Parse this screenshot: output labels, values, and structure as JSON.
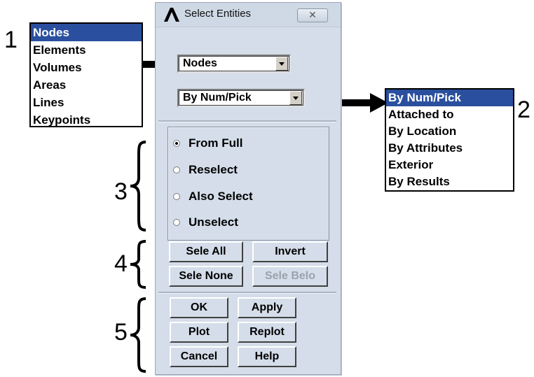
{
  "window": {
    "title": "Select Entities",
    "close_glyph": "✕"
  },
  "entity_combo": {
    "value": "Nodes"
  },
  "method_combo": {
    "value": "By Num/Pick"
  },
  "radio_options": [
    {
      "label": "From Full",
      "selected": true
    },
    {
      "label": "Reselect",
      "selected": false
    },
    {
      "label": "Also Select",
      "selected": false
    },
    {
      "label": "Unselect",
      "selected": false
    }
  ],
  "selection_buttons": {
    "sele_all": "Sele All",
    "invert": "Invert",
    "sele_none": "Sele None",
    "sele_belo": "Sele Belo"
  },
  "action_buttons": {
    "ok": "OK",
    "apply": "Apply",
    "plot": "Plot",
    "replot": "Replot",
    "cancel": "Cancel",
    "help": "Help"
  },
  "entity_list": [
    "Nodes",
    "Elements",
    "Volumes",
    "Areas",
    "Lines",
    "Keypoints"
  ],
  "method_list": [
    "By Num/Pick",
    "Attached to",
    "By Location",
    "By Attributes",
    "Exterior",
    "By Results"
  ],
  "callouts": [
    "1",
    "2",
    "3",
    "4",
    "5"
  ],
  "icons": [
    "ansys-logo-icon",
    "close-icon",
    "dropdown-arrow-icon",
    "arrow-icon",
    "brace-icon"
  ]
}
